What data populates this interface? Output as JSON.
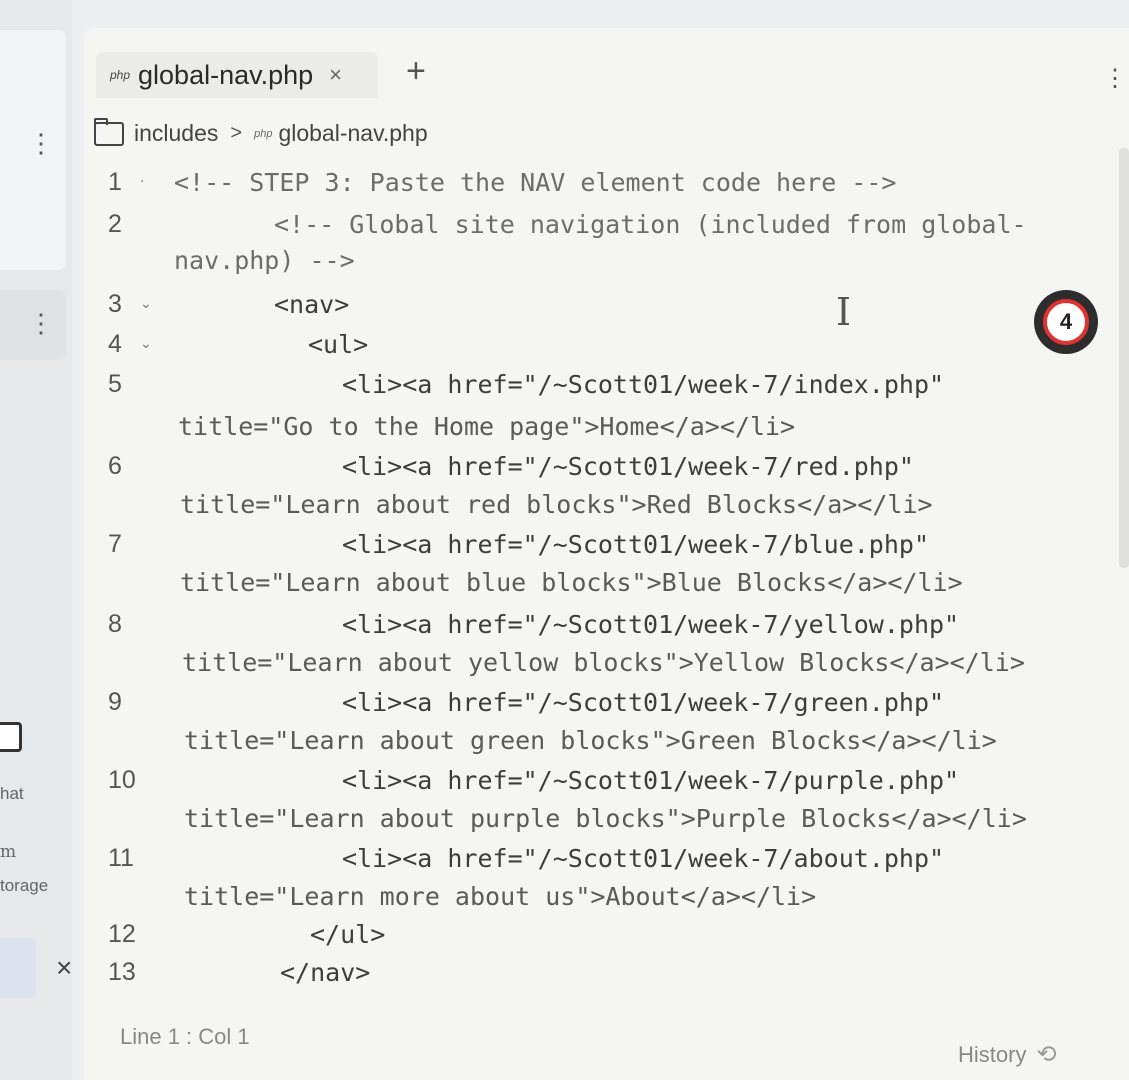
{
  "tab": {
    "icon": "php",
    "name": "global-nav.php",
    "close": "×",
    "add": "+"
  },
  "breadcrumb": {
    "folder": "includes",
    "sep": ">",
    "icon": "php",
    "file": "global-nav.php"
  },
  "sidebar": {
    "label1": "hat",
    "label2": "m",
    "label3": "torage",
    "close": "×"
  },
  "badge": {
    "count": "4"
  },
  "code": {
    "lines": [
      {
        "n": "1",
        "fold": "·",
        "text": "<!-- STEP 3: Paste the NAV element code here -->"
      },
      {
        "n": "2",
        "fold": "",
        "text": "<!-- Global site navigation (included from global-",
        "cont": "nav.php) -->"
      },
      {
        "n": "3",
        "fold": "⌄",
        "text": "<nav>"
      },
      {
        "n": "4",
        "fold": "⌄",
        "text": "<ul>"
      },
      {
        "n": "5",
        "fold": "",
        "text": "<li><a href=\"/~Scott01/week-7/index.php\"",
        "cont": "title=\"Go to the Home page\">Home</a></li>"
      },
      {
        "n": "6",
        "fold": "",
        "text": "<li><a href=\"/~Scott01/week-7/red.php\"",
        "cont": "title=\"Learn about red blocks\">Red Blocks</a></li>"
      },
      {
        "n": "7",
        "fold": "",
        "text": "<li><a href=\"/~Scott01/week-7/blue.php\"",
        "cont": "title=\"Learn about blue blocks\">Blue Blocks</a></li>"
      },
      {
        "n": "8",
        "fold": "",
        "text": "<li><a href=\"/~Scott01/week-7/yellow.php\"",
        "cont": "title=\"Learn about yellow blocks\">Yellow Blocks</a></li>"
      },
      {
        "n": "9",
        "fold": "",
        "text": "<li><a href=\"/~Scott01/week-7/green.php\"",
        "cont": "title=\"Learn about green blocks\">Green Blocks</a></li>"
      },
      {
        "n": "10",
        "fold": "",
        "text": "<li><a href=\"/~Scott01/week-7/purple.php\"",
        "cont": "title=\"Learn about purple blocks\">Purple Blocks</a></li>"
      },
      {
        "n": "11",
        "fold": "",
        "text": "<li><a href=\"/~Scott01/week-7/about.php\"",
        "cont": "title=\"Learn more about us\">About</a></li>"
      },
      {
        "n": "12",
        "fold": "",
        "text": "</ul>"
      },
      {
        "n": "13",
        "fold": "",
        "text": "</nav>"
      }
    ]
  },
  "status": {
    "position": "Line 1 : Col 1",
    "history": "History"
  }
}
